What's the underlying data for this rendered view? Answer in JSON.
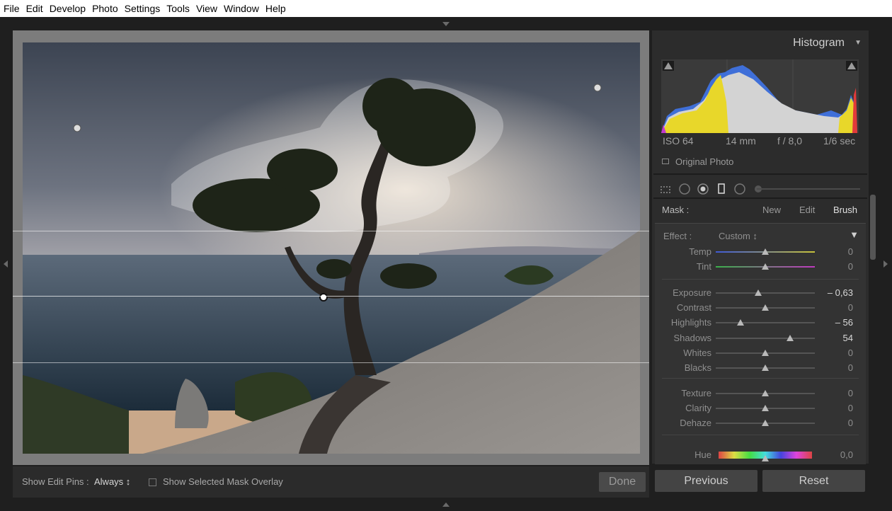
{
  "menu": [
    "File",
    "Edit",
    "Develop",
    "Photo",
    "Settings",
    "Tools",
    "View",
    "Window",
    "Help"
  ],
  "toolbar": {
    "show_pins_label": "Show Edit Pins :",
    "show_pins_value": "Always ↕",
    "overlay_label": "Show Selected Mask Overlay",
    "done_label": "Done"
  },
  "histogram": {
    "title": "Histogram",
    "caret": "▼",
    "iso": "ISO 64",
    "focal": "14 mm",
    "aperture": "f / 8,0",
    "shutter": "1/6 sec",
    "original_photo": "Original Photo"
  },
  "mask": {
    "label": "Mask :",
    "new": "New",
    "edit": "Edit",
    "brush": "Brush"
  },
  "effect": {
    "label": "Effect :",
    "preset": "Custom ↕",
    "sliders": [
      {
        "name": "Temp",
        "value": "0",
        "level": 0.5
      },
      {
        "name": "Tint",
        "value": "0",
        "level": 0.5
      },
      {
        "name": "Exposure",
        "value": "– 0,63",
        "level": 0.43
      },
      {
        "name": "Contrast",
        "value": "0",
        "level": 0.5
      },
      {
        "name": "Highlights",
        "value": "– 56",
        "level": 0.25
      },
      {
        "name": "Shadows",
        "value": "54",
        "level": 0.75
      },
      {
        "name": "Whites",
        "value": "0",
        "level": 0.5
      },
      {
        "name": "Blacks",
        "value": "0",
        "level": 0.5
      },
      {
        "name": "Texture",
        "value": "0",
        "level": 0.5
      },
      {
        "name": "Clarity",
        "value": "0",
        "level": 0.5
      },
      {
        "name": "Dehaze",
        "value": "0",
        "level": 0.5
      },
      {
        "name": "Hue",
        "value": "0,0",
        "level": 0.5
      }
    ]
  },
  "buttons": {
    "previous": "Previous",
    "reset": "Reset"
  }
}
